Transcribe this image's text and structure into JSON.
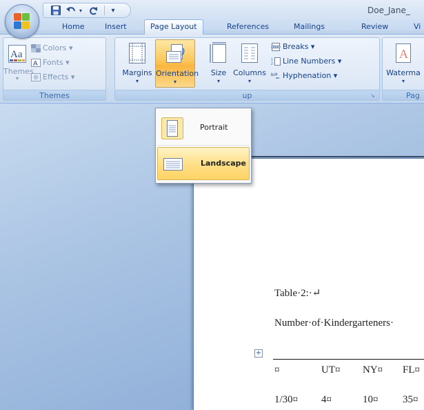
{
  "title_bar": {
    "document_title": "Doe_Jane_",
    "quick_access": {
      "save_icon": "save-icon",
      "undo_icon": "undo-icon",
      "redo_icon": "redo-icon",
      "customize_glyph": "▾"
    }
  },
  "tabs": [
    {
      "label": "Home"
    },
    {
      "label": "Insert"
    },
    {
      "label": "Page Layout"
    },
    {
      "label": "References"
    },
    {
      "label": "Mailings"
    },
    {
      "label": "Review"
    },
    {
      "label": "Vi"
    }
  ],
  "active_tab": "Page Layout",
  "ribbon": {
    "themes_group": {
      "label": "Themes",
      "themes_button": "Themes",
      "colors": "Colors ▾",
      "fonts": "Fonts ▾",
      "effects": "Effects ▾"
    },
    "page_setup_group": {
      "label": "up",
      "margins": "Margins",
      "orientation": "Orientation",
      "size": "Size",
      "columns": "Columns",
      "breaks": "Breaks ▾",
      "line_numbers": "Line Numbers ▾",
      "hyphenation": "Hyphenation ▾",
      "dropdown_arrow": "▾"
    },
    "page_background_group": {
      "label": "Pag",
      "watermark": "Waterma"
    }
  },
  "orientation_menu": {
    "items": [
      {
        "label": "Portrait",
        "icon": "portrait-page-icon"
      },
      {
        "label": "Landscape",
        "icon": "landscape-page-icon"
      }
    ],
    "highlighted": "Landscape"
  },
  "document": {
    "caption": "Table·2:·↵",
    "subtitle": "Number·of·Kindergarteners·",
    "table_header": [
      "¤",
      "UT¤",
      "NY¤",
      "FL¤"
    ],
    "table_row_1": [
      "1/30¤",
      "4¤",
      "10¤",
      "35¤"
    ]
  },
  "colors": {
    "ribbon_text": "#15428b",
    "active_highlight": "#fbc75a",
    "workspace": "#88a9d5"
  }
}
